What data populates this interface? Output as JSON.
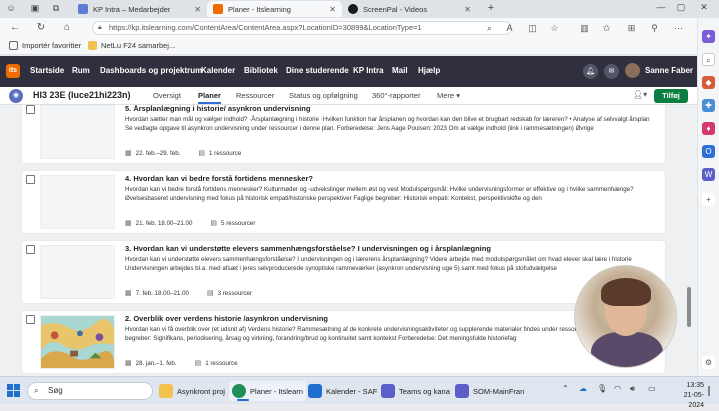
{
  "browser": {
    "tabs": [
      {
        "title": "KP Intra – Medarbejder",
        "favicon_color": "#5b7bd5"
      },
      {
        "title": "Planer - Itslearning",
        "favicon_color": "#f06c00"
      },
      {
        "title": "ScreenPal - Videos",
        "favicon_color": "#1a1a1a"
      }
    ],
    "url": "https://kp.itslearning.com/ContentArea/ContentArea.aspx?LocationID=30899&LocationType=1",
    "favorites": [
      {
        "label": "Importér favoritter"
      },
      {
        "label": "NetLu F24 samarbej..."
      }
    ]
  },
  "topnav": {
    "logo_text": "its",
    "items": [
      "Startside",
      "Rum",
      "Dashboards og projektrum",
      "Kalender",
      "Bibliotek",
      "Dine studerende",
      "KP Intra",
      "Mail",
      "Hjælp"
    ],
    "user_name": "Sanne Faber"
  },
  "course": {
    "title": "HI3 23E (luce21hi223n)",
    "tabs": [
      "Oversigt",
      "Planer",
      "Ressourcer",
      "Status og opfølgning",
      "360°-rapporter",
      "Mere"
    ],
    "active_tab": "Planer",
    "add_button": "Tilføj"
  },
  "plans": [
    {
      "title": "5. Årsplanlægning i historie/ asynkron undervisning",
      "description": "Hvordan sætter man mål og vælger indhold? ·Årsplanlægning i historie ·Hvilken funktion har årsplanen og hvordan kan den blive et brugbart redskab for læreren? • Analyse af selvvalgt årsplan Se vedlagte opgave til asynkron undervisning under ressourcer i denne plan.  Forberedelse: Jens Aage Poulsen: 2023 Om at vælge indhold (link i rammesætningen) Øvrige",
      "dates": "22. feb.–29. feb.",
      "resources": "1 ressource",
      "has_image": false
    },
    {
      "title": "4. Hvordan kan vi bedre forstå fortidens mennesker?",
      "description": "Hvordan kan vi bedre forstå fortidens mennesker? Kulturmøder og -udvekslinger mellem øst og vest Modulspørgsmål: Hvilke undervisningsformer er effektive og i hvilke sammenhænge? Øvelsesbaseret undervisning med fokus på historisk empati/historiske perspektiver  Faglige begreber: Historisk empati: Kontekst, perspektivskifte og den",
      "dates": "21. feb. 18.00–21.00",
      "resources": "5 ressourcer",
      "has_image": false
    },
    {
      "title": "3. Hvordan kan vi understøtte elevers sammenhængsforståelse? I undervisningen og i årsplanlægning",
      "description": "Hvordan kan vi understøtte elevers sammenhængsforståelse? I undervisningen og i lærerens årsplanlægning? Videre arbejde med modulspørgsmålet om hvad elever skal lære i historie Undervisningen arbejdes bl.a. med afsæt i jeres selvproducerede synoptiske rammeværker (asynkron undervisning uge 5) samt med fokus på stofudvælgelse",
      "dates": "7. feb. 18.00–21.00",
      "resources": "3 ressourcer",
      "has_image": false
    },
    {
      "title": "2. Overblik over verdens historie /asynkron undervisning",
      "description": "Hvordan kan vi få overblik over (et udsnit af) Verdens historie?  Rammesætning af de konkrete undervisningsaktiviteter og supplerende materialer findes under ressourcer i denne plan. Faglige begreber: Signifikans, periodisering, årsag og virkning, forandring/brud og kontinuitet samt kontekst Forberedelse: Det meningsfulde historiefag",
      "dates": "28. jan.–1. feb.",
      "resources": "1 ressource",
      "has_image": true
    }
  ],
  "taskbar": {
    "search_placeholder": "Søg",
    "apps": [
      {
        "label": "Asynkront proj",
        "color": "#f2c14e"
      },
      {
        "label": "Planer - Itslearn",
        "color": "#1f8f5a"
      },
      {
        "label": "Kalender - SAF",
        "color": "#1f6fd1"
      },
      {
        "label": "Teams og kana",
        "color": "#5b5fc7"
      },
      {
        "label": "SOM-MainFran",
        "color": "#5b5fc7"
      }
    ],
    "time": "13:35",
    "date": "21-05-2024"
  }
}
